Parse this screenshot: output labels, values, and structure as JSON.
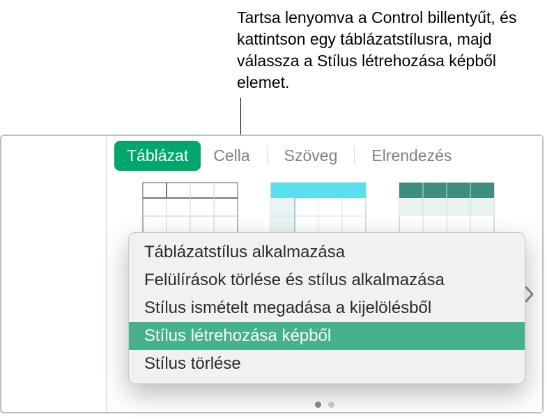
{
  "callout": {
    "text": "Tartsa lenyomva a Control billentyűt, és kattintson egy táblázatstílusra, majd válassza a Stílus létrehozása képből elemet."
  },
  "tabs": {
    "tablazat": "Táblázat",
    "cella": "Cella",
    "szoveg": "Szöveg",
    "elrendezes": "Elrendezés"
  },
  "styles": {
    "s1_name": "plain-table-style",
    "s2_name": "cyan-header-style",
    "s3_name": "teal-header-style",
    "s4_name": "grey-header-style"
  },
  "menu": {
    "apply": "Táblázatstílus alkalmazása",
    "clear_apply": "Felülírások törlése és stílus alkalmazása",
    "redefine": "Stílus ismételt megadása a kijelölésből",
    "create_from_image": "Stílus létrehozása képből",
    "delete": "Stílus törlése"
  },
  "colors": {
    "accent": "#00a76d",
    "menu_highlight": "#45b28c",
    "cyan": "#5bdff0",
    "teal": "#3e8e7e",
    "grey_hdr": "#a9a9a9"
  }
}
